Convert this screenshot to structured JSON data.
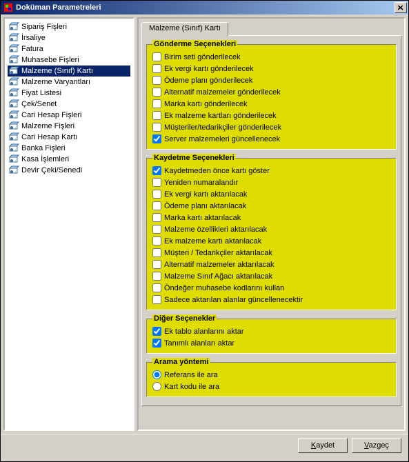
{
  "window": {
    "title": "Doküman Parametreleri"
  },
  "nav": {
    "items": [
      {
        "label": "Sipariş Fişleri"
      },
      {
        "label": "İrsaliye"
      },
      {
        "label": "Fatura"
      },
      {
        "label": "Muhasebe Fişleri"
      },
      {
        "label": "Malzeme (Sınıf) Kartı",
        "selected": true
      },
      {
        "label": "Malzeme Varyantları"
      },
      {
        "label": "Fiyat Listesi"
      },
      {
        "label": "Çek/Senet"
      },
      {
        "label": "Cari Hesap Fişleri"
      },
      {
        "label": "Malzeme Fişleri"
      },
      {
        "label": "Cari Hesap Kartı"
      },
      {
        "label": "Banka Fişleri"
      },
      {
        "label": "Kasa İşlemleri"
      },
      {
        "label": "Devir Çeki/Senedi"
      }
    ]
  },
  "tab": {
    "label": "Malzeme (Sınıf) Kartı"
  },
  "groups": {
    "send": {
      "legend": "Gönderme Seçenekleri",
      "items": [
        {
          "label": "Birim seti gönderilecek",
          "checked": false
        },
        {
          "label": "Ek vergi kartı gönderilecek",
          "checked": false
        },
        {
          "label": "Ödeme planı gönderilecek",
          "checked": false
        },
        {
          "label": "Alternatif malzemeler gönderilecek",
          "checked": false
        },
        {
          "label": "Marka kartı gönderilecek",
          "checked": false
        },
        {
          "label": "Ek malzeme kartları gönderilecek",
          "checked": false
        },
        {
          "label": "Müşteriler/tedarikçiler gönderilecek",
          "checked": false
        },
        {
          "label": "Server malzemeleri güncellenecek",
          "checked": true
        }
      ]
    },
    "save": {
      "legend": "Kaydetme Seçenekleri",
      "items": [
        {
          "label": "Kaydetmeden önce kartı göster",
          "checked": true
        },
        {
          "label": "Yeniden numaralandır",
          "checked": false
        },
        {
          "label": "Ek vergi kartı aktarılacak",
          "checked": false
        },
        {
          "label": "Ödeme planı aktarılacak",
          "checked": false
        },
        {
          "label": "Marka kartı aktarılacak",
          "checked": false
        },
        {
          "label": "Malzeme özellikleri aktarılacak",
          "checked": false
        },
        {
          "label": "Ek malzeme kartı aktarılacak",
          "checked": false
        },
        {
          "label": "Müşteri / Tedarikçiler aktarılacak",
          "checked": false
        },
        {
          "label": "Alternatif malzemeler aktarılacak",
          "checked": false
        },
        {
          "label": "Malzeme Sınıf Ağacı aktarılacak",
          "checked": false
        },
        {
          "label": "Öndeğer muhasebe kodlarını kullan",
          "checked": false
        },
        {
          "label": "Sadece aktarılan alanlar güncellenecektir",
          "checked": false
        }
      ]
    },
    "other": {
      "legend": "Diğer Seçenekler",
      "items": [
        {
          "label": "Ek tablo alanlarını aktar",
          "checked": true
        },
        {
          "label": "Tanımlı alanları aktar",
          "checked": true
        }
      ]
    },
    "search": {
      "legend": "Arama yöntemi",
      "items": [
        {
          "label": "Referans ile ara",
          "checked": true
        },
        {
          "label": "Kart kodu ile ara",
          "checked": false
        }
      ]
    }
  },
  "footer": {
    "save": "Kaydet",
    "cancel": "Vazgeç"
  }
}
